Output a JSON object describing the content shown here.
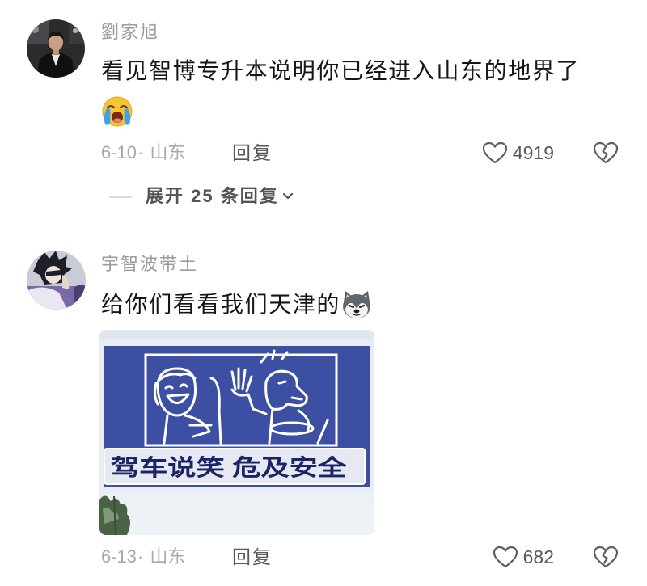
{
  "comments": [
    {
      "username": "劉家旭",
      "text": "看见智博专升本说明你已经进入山东的地界了",
      "emoji": "crying-face",
      "date": "6-10",
      "separator": "·",
      "location": "山东",
      "reply_label": "回复",
      "likes": "4919",
      "expand_label": "展开 25 条回复"
    },
    {
      "username": "宇智波带土",
      "text": "给你们看看我们天津的",
      "emoji": "husky-face",
      "image_text": "驾车说笑 危及安全",
      "date": "6-13",
      "separator": "·",
      "location": "山东",
      "reply_label": "回复",
      "likes": "682"
    }
  ],
  "icons": {
    "like": "heart-outline-icon",
    "dislike": "broken-heart-icon",
    "expand": "chevron-down-icon"
  },
  "colors": {
    "background": "#ffffff",
    "primary_text": "#161616",
    "secondary_text": "#a9a9a9",
    "action_text": "#585858",
    "sign_blue": "#3d4fa3"
  }
}
